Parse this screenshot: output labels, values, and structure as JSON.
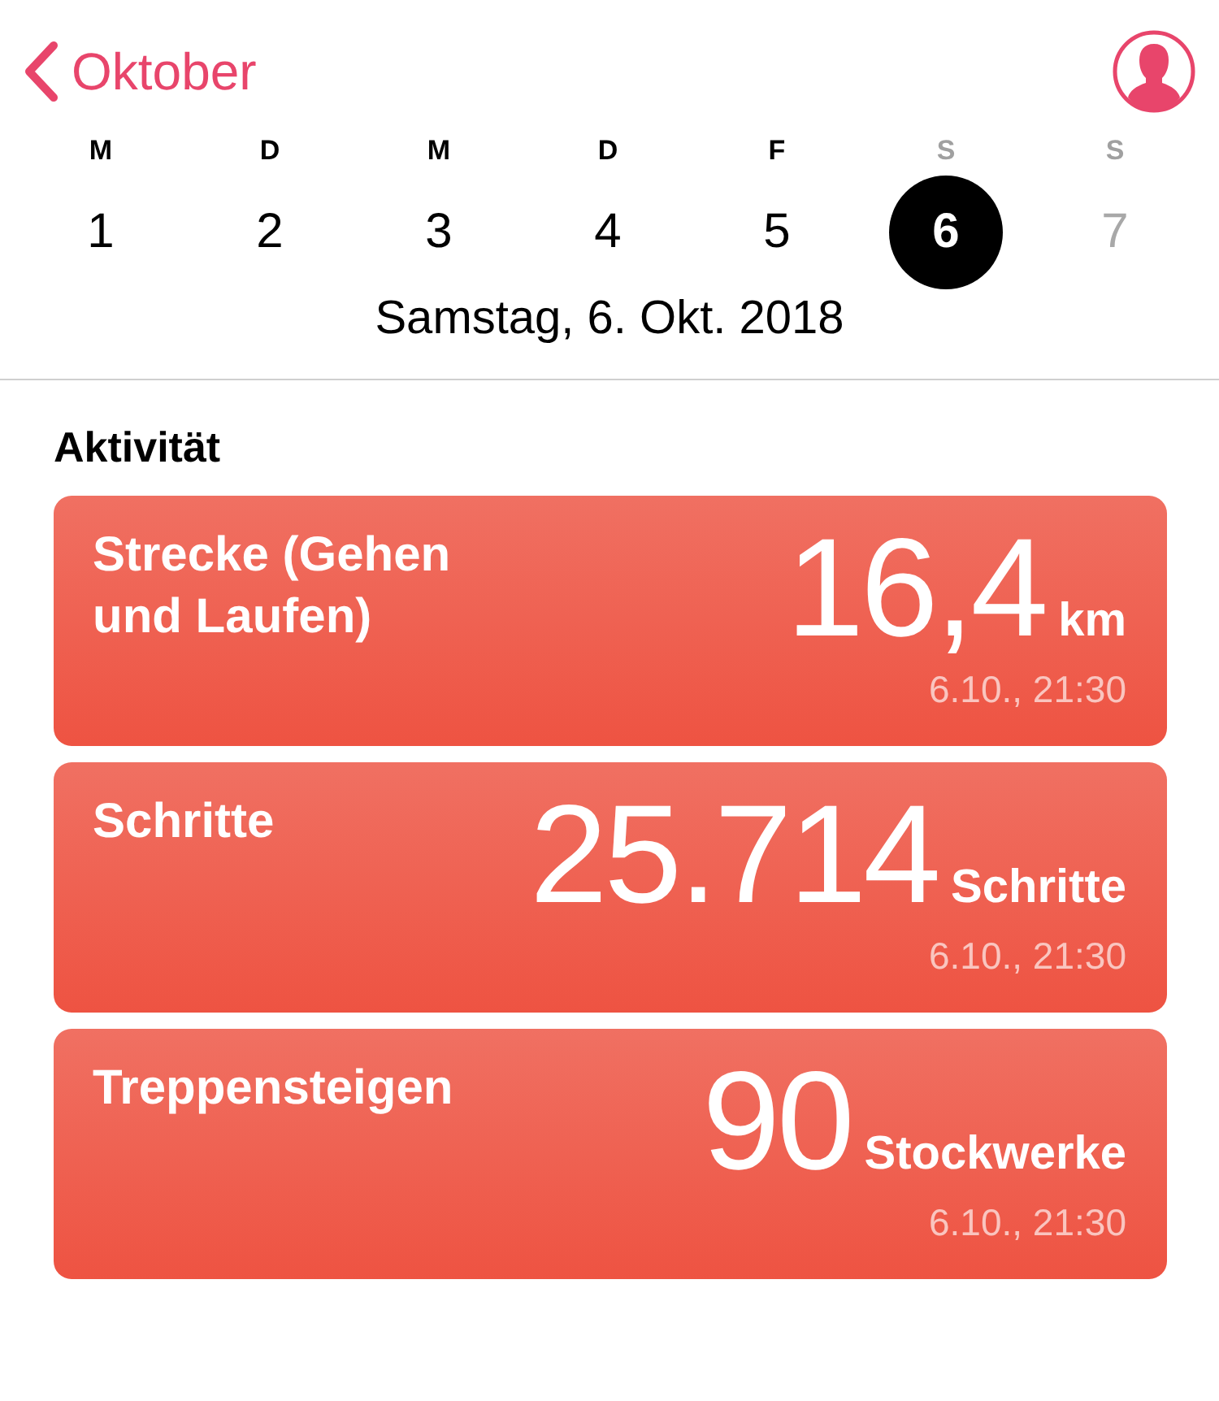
{
  "header": {
    "back_label": "Oktober"
  },
  "week": [
    {
      "weekday": "M",
      "day": "1",
      "dimmed": false,
      "selected": false
    },
    {
      "weekday": "D",
      "day": "2",
      "dimmed": false,
      "selected": false
    },
    {
      "weekday": "M",
      "day": "3",
      "dimmed": false,
      "selected": false
    },
    {
      "weekday": "D",
      "day": "4",
      "dimmed": false,
      "selected": false
    },
    {
      "weekday": "F",
      "day": "5",
      "dimmed": false,
      "selected": false
    },
    {
      "weekday": "S",
      "day": "6",
      "dimmed": false,
      "selected": true
    },
    {
      "weekday": "S",
      "day": "7",
      "dimmed": true,
      "selected": false
    }
  ],
  "weekend_labels_dimmed": true,
  "date_label": "Samstag, 6. Okt. 2018",
  "section_title": "Aktivität",
  "cards": [
    {
      "title": "Strecke (Gehen und Laufen)",
      "value": "16,4",
      "unit": "km",
      "time": "6.10., 21:30"
    },
    {
      "title": "Schritte",
      "value": "25.714",
      "unit": "Schritte",
      "time": "6.10., 21:30"
    },
    {
      "title": "Treppensteigen",
      "value": "90",
      "unit": "Stockwerke",
      "time": "6.10., 21:30"
    }
  ]
}
